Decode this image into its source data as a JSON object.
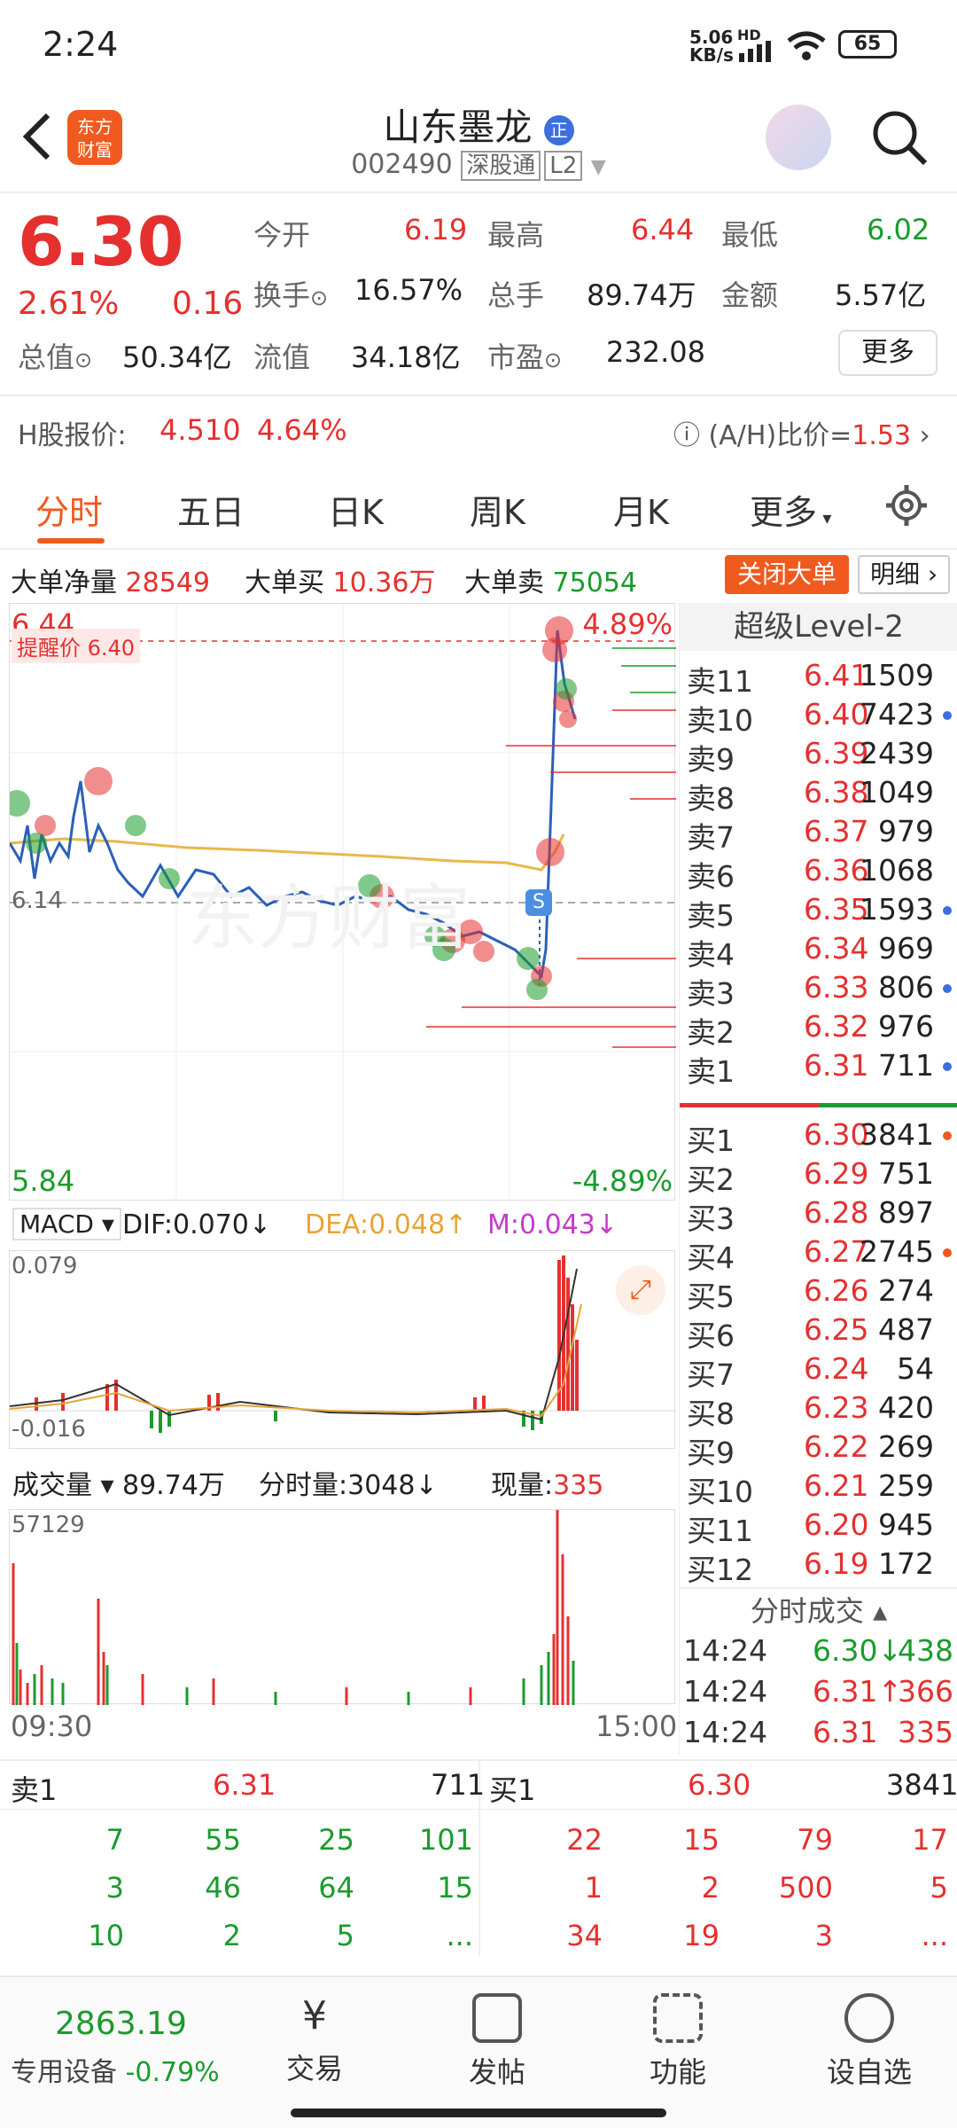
{
  "status": {
    "time": "2:24",
    "net_speed": "5.06",
    "net_unit": "KB/s",
    "hd": "HD",
    "battery": "65"
  },
  "header": {
    "title": "山东墨龙",
    "badge": "正",
    "code": "002490",
    "market": "深股通",
    "level": "L2",
    "logo_line1": "东方",
    "logo_line2": "财富"
  },
  "quote": {
    "price": "6.30",
    "pct": "2.61%",
    "chg": "0.16",
    "open_label": "今开",
    "open": "6.19",
    "high_label": "最高",
    "high": "6.44",
    "low_label": "最低",
    "low": "6.02",
    "turnover_label": "换手",
    "turnover": "16.57%",
    "vol_label": "总手",
    "vol": "89.74万",
    "amt_label": "金额",
    "amt": "5.57亿",
    "mcap_label": "总值",
    "mcap": "50.34亿",
    "float_label": "流值",
    "float": "34.18亿",
    "pe_label": "市盈",
    "pe": "232.08",
    "more": "更多",
    "h_label": "H股报价:",
    "h_price": "4.510",
    "h_pct": "4.64%",
    "ah_label": "(A/H)比价=",
    "ah": "1.53"
  },
  "tabs": [
    "分时",
    "五日",
    "日K",
    "周K",
    "月K",
    "更多"
  ],
  "bigorder": {
    "net_label": "大单净量",
    "net": "28549",
    "buy_label": "大单买",
    "buy": "10.36万",
    "sell_label": "大单卖",
    "sell": "75054",
    "close_btn": "关闭大单",
    "detail_btn": "明细"
  },
  "chart": {
    "top_price": "6.44",
    "top_pct": "4.89%",
    "bottom_price": "5.84",
    "bottom_pct": "-4.89%",
    "mid_price": "6.14",
    "alert": "提醒价 6.40",
    "watermark": "东方财富",
    "macd_label": "MACD",
    "dif": "DIF:0.070↓",
    "dea": "DEA:0.048↑",
    "m": "M:0.043↓",
    "macd_max": "0.079",
    "macd_min": "-0.016",
    "vol_label": "成交量",
    "vol_total": "89.74万",
    "vol_min_label": "分时量:3048↓",
    "vol_now_label": "现量:",
    "vol_now": "335",
    "vol_max": "57129",
    "t_start": "09:30",
    "t_end": "15:00"
  },
  "chart_data": {
    "type": "line",
    "price_range": [
      5.84,
      6.44
    ],
    "prev_close": 6.14
  },
  "level2": {
    "title": "超级Level-2",
    "asks": [
      {
        "l": "卖11",
        "p": "6.41",
        "v": "1509",
        "dot": false
      },
      {
        "l": "卖10",
        "p": "6.40",
        "v": "7423",
        "dot": true
      },
      {
        "l": "卖9",
        "p": "6.39",
        "v": "2439",
        "dot": false
      },
      {
        "l": "卖8",
        "p": "6.38",
        "v": "1049",
        "dot": false
      },
      {
        "l": "卖7",
        "p": "6.37",
        "v": "979",
        "dot": false
      },
      {
        "l": "卖6",
        "p": "6.36",
        "v": "1068",
        "dot": false
      },
      {
        "l": "卖5",
        "p": "6.35",
        "v": "1593",
        "dot": true
      },
      {
        "l": "卖4",
        "p": "6.34",
        "v": "969",
        "dot": false
      },
      {
        "l": "卖3",
        "p": "6.33",
        "v": "806",
        "dot": true
      },
      {
        "l": "卖2",
        "p": "6.32",
        "v": "976",
        "dot": false
      },
      {
        "l": "卖1",
        "p": "6.31",
        "v": "711",
        "dot": true
      }
    ],
    "bids": [
      {
        "l": "买1",
        "p": "6.30",
        "v": "3841",
        "dot": true
      },
      {
        "l": "买2",
        "p": "6.29",
        "v": "751",
        "dot": false
      },
      {
        "l": "买3",
        "p": "6.28",
        "v": "897",
        "dot": false
      },
      {
        "l": "买4",
        "p": "6.27",
        "v": "2745",
        "dot": true
      },
      {
        "l": "买5",
        "p": "6.26",
        "v": "274",
        "dot": false
      },
      {
        "l": "买6",
        "p": "6.25",
        "v": "487",
        "dot": false
      },
      {
        "l": "买7",
        "p": "6.24",
        "v": "54",
        "dot": false
      },
      {
        "l": "买8",
        "p": "6.23",
        "v": "420",
        "dot": false
      },
      {
        "l": "买9",
        "p": "6.22",
        "v": "269",
        "dot": false
      },
      {
        "l": "买10",
        "p": "6.21",
        "v": "259",
        "dot": false
      },
      {
        "l": "买11",
        "p": "6.20",
        "v": "945",
        "dot": false
      },
      {
        "l": "买12",
        "p": "6.19",
        "v": "172",
        "dot": false
      }
    ],
    "ticks_title": "分时成交",
    "ticks": [
      {
        "t": "14:24",
        "p": "6.30↓",
        "v": "438",
        "c": "green"
      },
      {
        "t": "14:24",
        "p": "6.31↑",
        "v": "366",
        "c": "red"
      },
      {
        "t": "14:24",
        "p": "6.31",
        "v": "335",
        "c": "red"
      }
    ]
  },
  "queue": {
    "ask_label": "卖1",
    "ask_price": "6.31",
    "ask_total": "711",
    "bid_label": "买1",
    "bid_price": "6.30",
    "bid_total": "3841",
    "ask_rows": [
      [
        "7",
        "55",
        "25",
        "101"
      ],
      [
        "3",
        "46",
        "64",
        "15"
      ],
      [
        "10",
        "2",
        "5",
        "..."
      ]
    ],
    "bid_rows": [
      [
        "22",
        "15",
        "79",
        "17"
      ],
      [
        "1",
        "2",
        "500",
        "5"
      ],
      [
        "34",
        "19",
        "3",
        "..."
      ]
    ]
  },
  "bottom": {
    "index": "2863.19",
    "device": "专用设备",
    "index_pct": "-0.79%",
    "trade": "交易",
    "post": "发帖",
    "func": "功能",
    "watch": "设自选"
  }
}
